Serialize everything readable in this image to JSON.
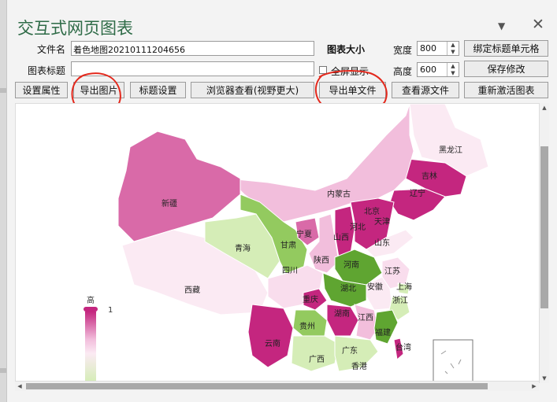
{
  "pane": {
    "title": "交互式网页图表"
  },
  "form": {
    "file_name_label": "文件名",
    "file_name_value": "着色地图20210111204656",
    "chart_title_label": "图表标题",
    "chart_title_value": "",
    "fullscreen_label": "全屏显示",
    "chart_size_label": "图表大小",
    "width_label": "宽度",
    "width_value": "800",
    "height_label": "高度",
    "height_value": "600"
  },
  "buttons": {
    "bind_title_cell": "绑定标题单元格",
    "save_changes": "保存修改",
    "set_properties": "设置属性",
    "export_image": "导出图片",
    "title_settings": "标题设置",
    "browser_view": "浏览器查看(视野更大)",
    "export_single_file": "导出单文件",
    "view_source": "查看源文件",
    "reactivate_chart": "重新激活图表"
  },
  "map": {
    "provinces": [
      "黑龙江",
      "吉林",
      "辽宁",
      "内蒙古",
      "北京",
      "天津",
      "河北",
      "山西",
      "山东",
      "新疆",
      "青海",
      "甘肃",
      "宁夏",
      "陕西",
      "河南",
      "江苏",
      "安徽",
      "上海",
      "西藏",
      "四川",
      "重庆",
      "湖北",
      "浙江",
      "湖南",
      "江西",
      "贵州",
      "云南",
      "福建",
      "广西",
      "广东",
      "台湾",
      "香港"
    ],
    "legend_high": "高",
    "legend_value": "1",
    "colors": {
      "high": "#c4267f",
      "mid_high": "#d96aa8",
      "mid": "#f2bedc",
      "low_pink": "#f9dded",
      "very_light": "#fbeaf3",
      "light_green": "#d5edb7",
      "mid_green": "#93ca5f",
      "dark_green": "#5fa531"
    }
  }
}
